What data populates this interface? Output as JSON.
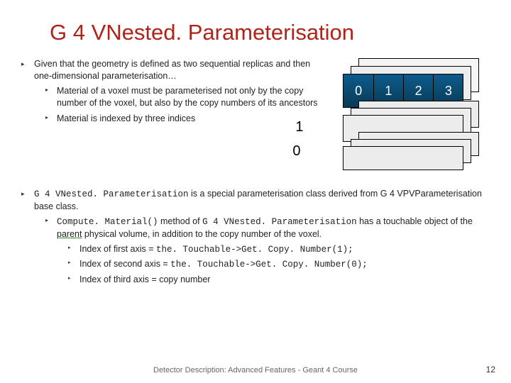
{
  "title": "G 4 VNested. Parameterisation",
  "bullet1": {
    "intro": "Given that the geometry is defined as two sequential replicas and then one-dimensional parameterisation…",
    "sub1": "Material of a voxel must be parameterised not only by the copy number of the voxel, but also by the copy numbers of its ancestors",
    "sub2": "Material is indexed by three indices"
  },
  "bullet2": {
    "lead1a": "G 4 VNested. Parameterisation",
    "lead1b": " is a special parameterisation class derived from G 4 VPVParameterisation base class.",
    "m_code": "Compute. Material()",
    "m_text1": " method of ",
    "m_class": "G 4 VNested. Parameterisation",
    "m_text2": " has a touchable object of the ",
    "m_parent": "parent",
    "m_text3": " physical volume, in addition to the copy number of the voxel.",
    "idx1a": "Index of first axis = ",
    "idx1b": "the. Touchable->Get. Copy. Number(1);",
    "idx2a": "Index of second axis = ",
    "idx2b": "the. Touchable->Get. Copy. Number(0);",
    "idx3": "Index of third axis = copy number"
  },
  "diagram": {
    "cells": [
      "0",
      "1",
      "2",
      "3"
    ],
    "row_mid": "1",
    "row_bottom": "0"
  },
  "footer": "Detector Description: Advanced Features - Geant 4 Course",
  "page": "12"
}
